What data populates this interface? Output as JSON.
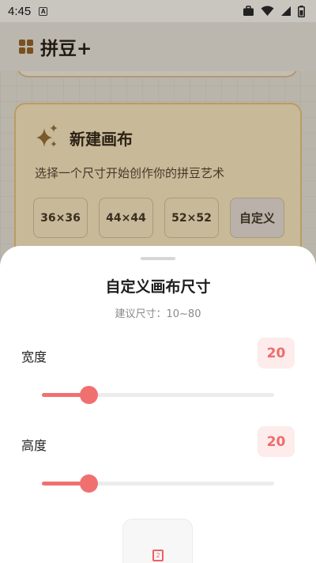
{
  "status_bar": {
    "time": "4:45",
    "notification_letter": "A"
  },
  "app": {
    "title": "拼豆+"
  },
  "new_canvas_card": {
    "title": "新建画布",
    "description": "选择一个尺寸开始创作你的拼豆艺术",
    "size_options": [
      "36×36",
      "44×44",
      "52×52"
    ],
    "custom_label": "自定义"
  },
  "custom_size_sheet": {
    "title": "自定义画布尺寸",
    "hint": "建议尺寸：10~80",
    "width": {
      "label": "宽度",
      "value": "20",
      "slider_fraction": 0.2
    },
    "height": {
      "label": "高度",
      "value": "20",
      "slider_fraction": 0.2
    },
    "preview_icon_text": "2",
    "accent_color": "#f07070",
    "accent_bg": "#fdeceb"
  }
}
